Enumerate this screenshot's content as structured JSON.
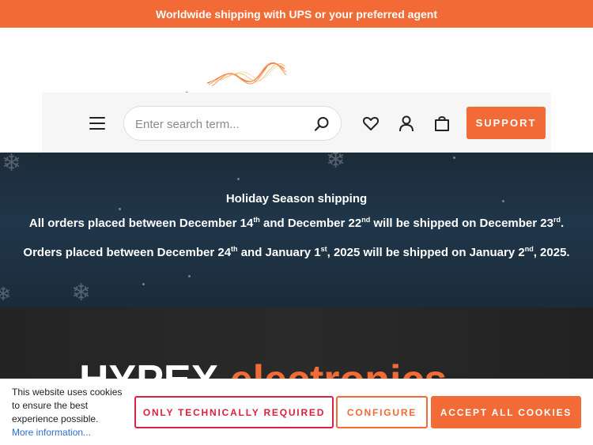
{
  "announcement": "Worldwide shipping with UPS or your preferred agent",
  "logo": {
    "main": "hypex",
    "sub": "electronics"
  },
  "search": {
    "placeholder": "Enter search term..."
  },
  "nav": {
    "support_label": "SUPPORT"
  },
  "holiday": {
    "title": "Holiday Season shipping",
    "line1": {
      "a": "All orders placed between December 14",
      "a_sup": "th",
      "b": " and December 22",
      "b_sup": "nd",
      "c": " will be shipped on December 23",
      "c_sup": "rd",
      "d": "."
    },
    "line2": {
      "a": "Orders placed between December 24",
      "a_sup": "th",
      "b": " and January 1",
      "b_sup": "st",
      "c": ", 2025 will be shipped on January 2",
      "c_sup": "nd",
      "d": ", 2025."
    }
  },
  "hero": {
    "word1": "HYPEX",
    "word2": "electronics"
  },
  "cookie": {
    "text": "This website uses cookies to ensure the best experience possible.",
    "more": "More information...",
    "btn_required": "ONLY TECHNICALLY REQUIRED",
    "btn_configure": "CONFIGURE",
    "btn_accept": "ACCEPT ALL COOKIES"
  },
  "colors": {
    "accent": "#f26a35",
    "danger": "#d8223f",
    "banner_bg": "#1f3244"
  }
}
